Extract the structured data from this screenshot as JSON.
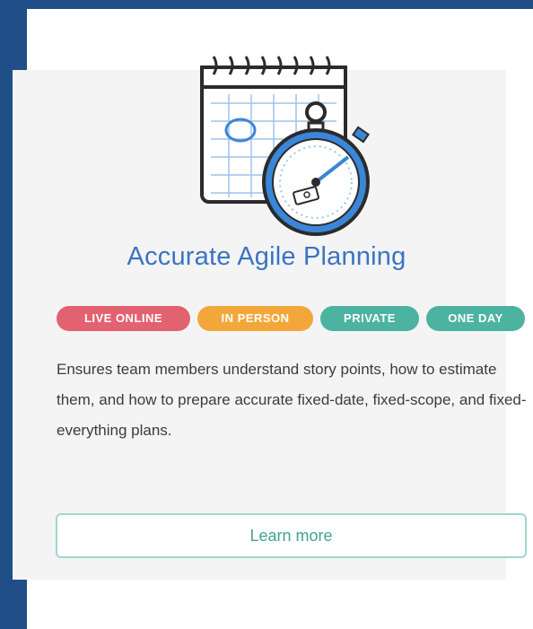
{
  "course": {
    "title": "Accurate Agile Planning",
    "badges": [
      "LIVE ONLINE",
      "IN PERSON",
      "PRIVATE",
      "ONE DAY"
    ],
    "description": "Ensures team members understand story points, how to estimate them, and how to prepare accurate fixed-date, fixed-scope, and fixed-everything plans.",
    "cta_label": "Learn more",
    "illustration_icon": "calendar-stopwatch-icon"
  },
  "colors": {
    "background": "#1f4f86",
    "title": "#3a74c4",
    "badge_live_online": "#e2626f",
    "badge_in_person": "#f3a73a",
    "badge_private": "#4cb3a1",
    "badge_one_day": "#4cb3a1",
    "cta_border": "#9fd6cf",
    "cta_text": "#42a392"
  }
}
